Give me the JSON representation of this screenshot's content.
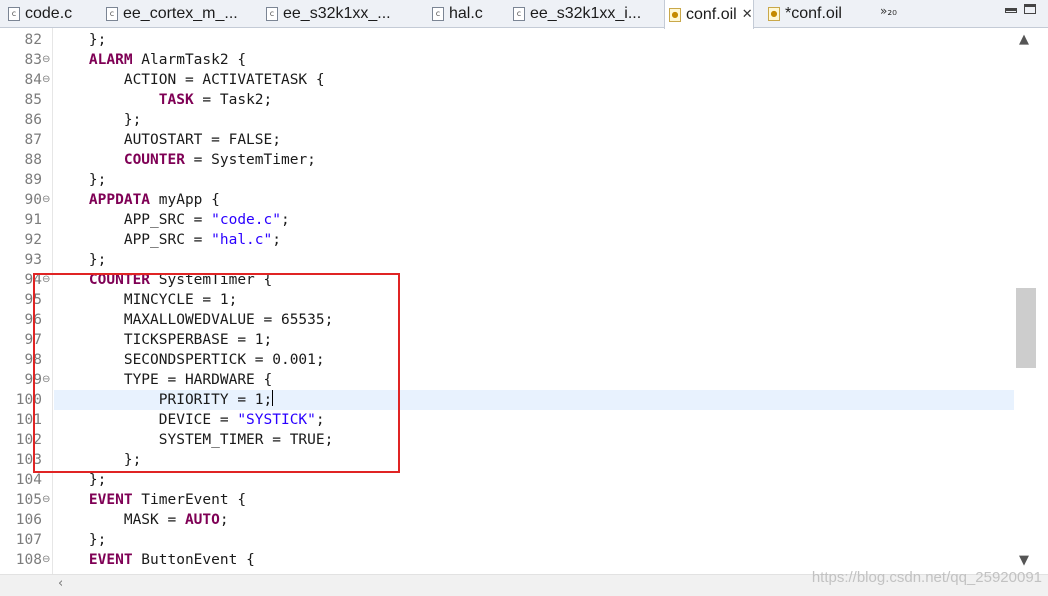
{
  "tabs": [
    {
      "label": "code.c",
      "icon": "c-file-icon"
    },
    {
      "label": "ee_cortex_m_...",
      "icon": "c-file-icon"
    },
    {
      "label": "ee_s32k1xx_...",
      "icon": "c-file-icon"
    },
    {
      "label": "hal.c",
      "icon": "c-file-icon"
    },
    {
      "label": "ee_s32k1xx_i...",
      "icon": "c-file-icon"
    },
    {
      "label": "conf.oil",
      "icon": "oil-file-icon",
      "active": true,
      "close": "✕"
    },
    {
      "label": "*conf.oil",
      "icon": "oil-file-icon"
    }
  ],
  "tab_overflow": "»₂₀",
  "editor": {
    "current_line": 100,
    "highlight_box_lines": "94-103",
    "lines": [
      {
        "n": "82",
        "fold": "",
        "tokens": [
          [
            "t",
            "    };"
          ]
        ]
      },
      {
        "n": "83",
        "fold": "⊖",
        "tokens": [
          [
            "t",
            "    "
          ],
          [
            "k",
            "ALARM"
          ],
          [
            "t",
            " AlarmTask2 {"
          ]
        ]
      },
      {
        "n": "84",
        "fold": "⊖",
        "tokens": [
          [
            "t",
            "        ACTION = ACTIVATETASK {"
          ]
        ]
      },
      {
        "n": "85",
        "fold": "",
        "tokens": [
          [
            "t",
            "            "
          ],
          [
            "k",
            "TASK"
          ],
          [
            "t",
            " = Task2;"
          ]
        ]
      },
      {
        "n": "86",
        "fold": "",
        "tokens": [
          [
            "t",
            "        };"
          ]
        ]
      },
      {
        "n": "87",
        "fold": "",
        "tokens": [
          [
            "t",
            "        AUTOSTART = FALSE;"
          ]
        ]
      },
      {
        "n": "88",
        "fold": "",
        "tokens": [
          [
            "t",
            "        "
          ],
          [
            "k",
            "COUNTER"
          ],
          [
            "t",
            " = SystemTimer;"
          ]
        ]
      },
      {
        "n": "89",
        "fold": "",
        "tokens": [
          [
            "t",
            "    };"
          ]
        ]
      },
      {
        "n": "90",
        "fold": "⊖",
        "tokens": [
          [
            "t",
            "    "
          ],
          [
            "k",
            "APPDATA"
          ],
          [
            "t",
            " myApp {"
          ]
        ]
      },
      {
        "n": "91",
        "fold": "",
        "tokens": [
          [
            "t",
            "        APP_SRC = "
          ],
          [
            "s",
            "\"code.c\""
          ],
          [
            "t",
            ";"
          ]
        ]
      },
      {
        "n": "92",
        "fold": "",
        "tokens": [
          [
            "t",
            "        APP_SRC = "
          ],
          [
            "s",
            "\"hal.c\""
          ],
          [
            "t",
            ";"
          ]
        ]
      },
      {
        "n": "93",
        "fold": "",
        "tokens": [
          [
            "t",
            "    };"
          ]
        ]
      },
      {
        "n": "94",
        "fold": "⊖",
        "tokens": [
          [
            "t",
            "    "
          ],
          [
            "k",
            "COUNTER"
          ],
          [
            "t",
            " SystemTimer {"
          ]
        ]
      },
      {
        "n": "95",
        "fold": "",
        "tokens": [
          [
            "t",
            "        MINCYCLE = 1;"
          ]
        ]
      },
      {
        "n": "96",
        "fold": "",
        "tokens": [
          [
            "t",
            "        MAXALLOWEDVALUE = 65535;"
          ]
        ]
      },
      {
        "n": "97",
        "fold": "",
        "tokens": [
          [
            "t",
            "        TICKSPERBASE = 1;"
          ]
        ]
      },
      {
        "n": "98",
        "fold": "",
        "tokens": [
          [
            "t",
            "        SECONDSPERTICK = 0.001;"
          ]
        ]
      },
      {
        "n": "99",
        "fold": "⊖",
        "tokens": [
          [
            "t",
            "        TYPE = HARDWARE {"
          ]
        ]
      },
      {
        "n": "100",
        "fold": "",
        "tokens": [
          [
            "t",
            "            PRIORITY = 1;"
          ],
          [
            "c",
            ""
          ]
        ]
      },
      {
        "n": "101",
        "fold": "",
        "tokens": [
          [
            "t",
            "            DEVICE = "
          ],
          [
            "s",
            "\"SYSTICK\""
          ],
          [
            "t",
            ";"
          ]
        ]
      },
      {
        "n": "102",
        "fold": "",
        "tokens": [
          [
            "t",
            "            SYSTEM_TIMER = TRUE;"
          ]
        ]
      },
      {
        "n": "103",
        "fold": "",
        "tokens": [
          [
            "t",
            "        };"
          ]
        ]
      },
      {
        "n": "104",
        "fold": "",
        "tokens": [
          [
            "t",
            "    };"
          ]
        ]
      },
      {
        "n": "105",
        "fold": "⊖",
        "tokens": [
          [
            "t",
            "    "
          ],
          [
            "k",
            "EVENT"
          ],
          [
            "t",
            " TimerEvent {"
          ]
        ]
      },
      {
        "n": "106",
        "fold": "",
        "tokens": [
          [
            "t",
            "        MASK = "
          ],
          [
            "k",
            "AUTO"
          ],
          [
            "t",
            ";"
          ]
        ]
      },
      {
        "n": "107",
        "fold": "",
        "tokens": [
          [
            "t",
            "    };"
          ]
        ]
      },
      {
        "n": "108",
        "fold": "⊖",
        "tokens": [
          [
            "t",
            "    "
          ],
          [
            "k",
            "EVENT"
          ],
          [
            "t",
            " ButtonEvent {"
          ]
        ]
      }
    ]
  },
  "scroll": {
    "up": "▲",
    "down": "▼",
    "left": "‹"
  },
  "watermark": "https://blog.csdn.net/qq_25920091",
  "colors": {
    "keyword": "#7f0055",
    "string": "#2a00ff",
    "highlight_box": "#e02424",
    "current_line": "#e8f2fe"
  }
}
